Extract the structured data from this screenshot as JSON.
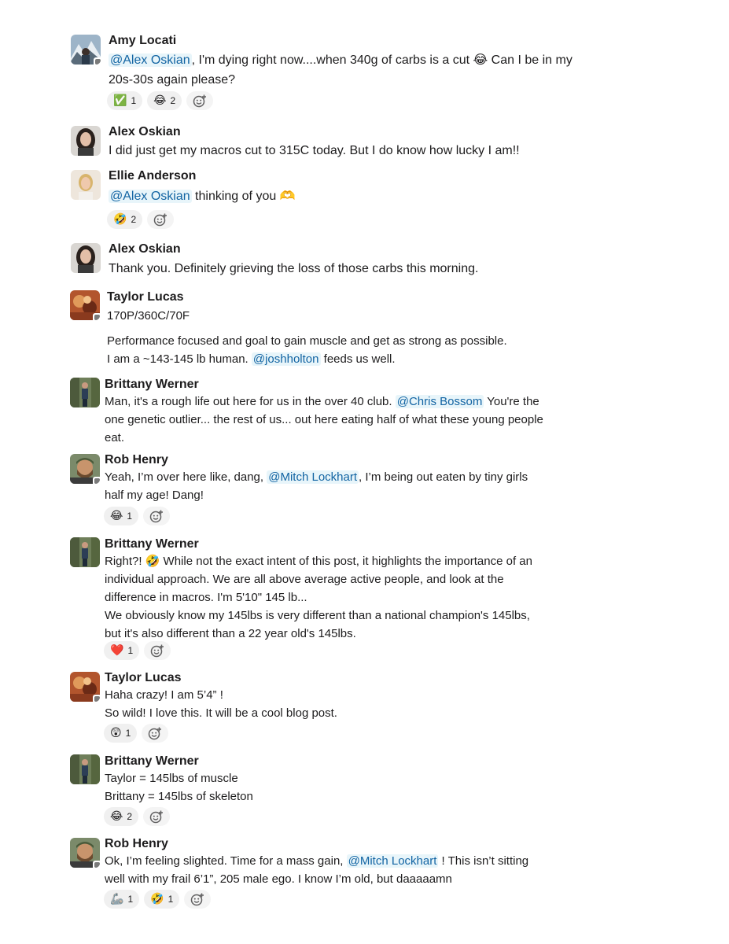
{
  "messages": [
    {
      "author": "Amy Locati",
      "lines": [
        [
          "@Alex Oskian",
          ", I'm dying right now....when 340g of carbs is a cut ",
          "😂",
          " Can I be in my"
        ],
        [
          "20s-30s again please?"
        ]
      ],
      "reactions": [
        {
          "emoji": "✅",
          "count": "1"
        },
        {
          "emoji": "😂",
          "count": "2"
        }
      ]
    },
    {
      "author": "Alex Oskian",
      "lines": [
        [
          "I did just get my macros cut to 315C today. But I do know how lucky I am!!"
        ]
      ]
    },
    {
      "author": "Ellie Anderson",
      "lines": [
        [
          "@Alex Oskian",
          " thinking of you ",
          "🫶"
        ]
      ],
      "reactions": [
        {
          "emoji": "🤣",
          "count": "2"
        }
      ]
    },
    {
      "author": "Alex Oskian",
      "lines": [
        [
          "Thank you. Definitely grieving the loss of those carbs this morning."
        ]
      ]
    },
    {
      "author": "Taylor Lucas",
      "lines": [
        [
          "170P/360C/70F"
        ],
        [
          "Performance focused and goal to gain muscle and get as strong as possible."
        ],
        [
          "I am a ~143-145 lb human. ",
          "@joshholton",
          " feeds us well."
        ]
      ]
    },
    {
      "author": "Brittany Werner",
      "lines": [
        [
          "Man, it's a rough life out here for us in the over 40 club. ",
          "@Chris Bossom",
          " You're the"
        ],
        [
          "one genetic outlier... the rest of us... out here eating half of what these young people"
        ],
        [
          "eat."
        ]
      ]
    },
    {
      "author": "Rob Henry",
      "lines": [
        [
          "Yeah, I’m over here like, dang, ",
          "@Mitch Lockhart",
          ", I’m being out eaten by tiny girls"
        ],
        [
          "half my age! Dang!"
        ]
      ],
      "reactions": [
        {
          "emoji": "😂",
          "count": "1"
        }
      ]
    },
    {
      "author": "Brittany Werner",
      "lines": [
        [
          "Right?! ",
          "🤣",
          " While not the exact intent of this post, it highlights the importance of an"
        ],
        [
          "individual approach. We are all above average active people, and look at the"
        ],
        [
          "difference in macros. I'm  5'10\" 145 lb..."
        ],
        [
          "We obviously know my 145lbs is very different than a national champion's 145lbs,"
        ],
        [
          "but it's also different than a 22 year old's 145lbs."
        ]
      ],
      "reactions": [
        {
          "emoji": "❤️",
          "count": "1"
        }
      ]
    },
    {
      "author": "Taylor Lucas",
      "lines": [
        [
          "Haha crazy! I am 5’4” !"
        ],
        [
          "So wild! I love this. It will be a cool blog post."
        ]
      ],
      "reactions": [
        {
          "emoji": "😲",
          "count": "1"
        }
      ]
    },
    {
      "author": "Brittany Werner",
      "lines": [
        [
          "Taylor = 145lbs of muscle"
        ],
        [
          "Brittany = 145lbs of skeleton"
        ]
      ],
      "reactions": [
        {
          "emoji": "😂",
          "count": "2"
        }
      ]
    },
    {
      "author": "Rob Henry",
      "lines": [
        [
          "Ok, I’m feeling slighted. Time for a mass gain, ",
          "@Mitch Lockhart",
          " ! This isn’t sitting"
        ],
        [
          "well with my frail 6’1”, 205 male ego. I know I’m old, but daaaaamn"
        ]
      ],
      "reactions": [
        {
          "emoji": "🦾",
          "count": "1"
        },
        {
          "emoji": "🤣",
          "count": "1"
        }
      ]
    }
  ],
  "icons": {
    "add_reaction": "add-reaction-icon",
    "presence": "away-status-icon"
  },
  "colors": {
    "mention_text": "#1264a3",
    "mention_bg": "#e8f5fa",
    "reaction_bg": "#f0f0f0",
    "text": "#1d1c1d"
  }
}
